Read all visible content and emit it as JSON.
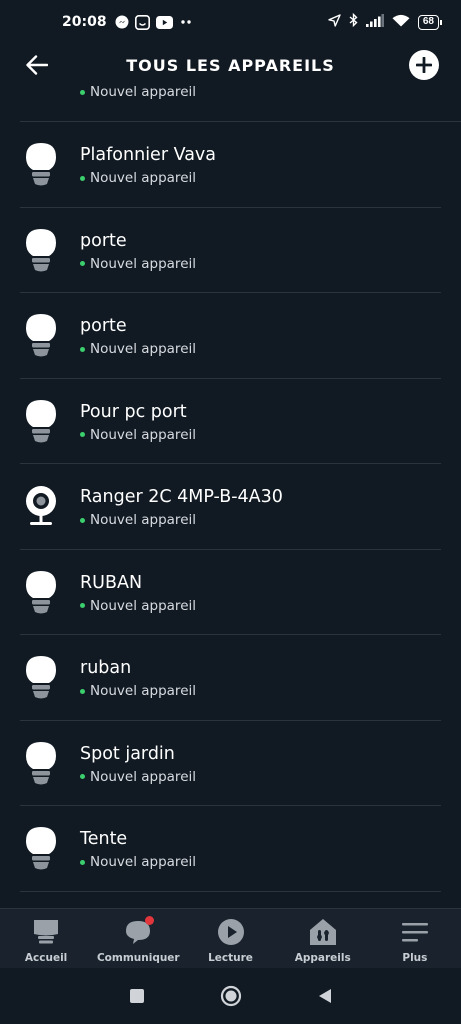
{
  "statusbar": {
    "time": "20:08",
    "battery": "68",
    "icons": [
      "messenger-icon",
      "app-icon",
      "youtube-icon",
      "more-dots-icon",
      "location-arrow-icon",
      "bluetooth-icon",
      "signal-icon",
      "wifi-icon",
      "battery-icon"
    ]
  },
  "header": {
    "title": "TOUS LES APPAREILS",
    "back_icon": "arrow-left-icon",
    "add_icon": "plus-circle-icon"
  },
  "partial_item": {
    "status": "Nouvel appareil"
  },
  "devices": [
    {
      "name": "Plafonnier Vava",
      "status": "Nouvel appareil",
      "icon": "bulb-icon"
    },
    {
      "name": "porte",
      "status": "Nouvel appareil",
      "icon": "bulb-icon"
    },
    {
      "name": "porte",
      "status": "Nouvel appareil",
      "icon": "bulb-icon"
    },
    {
      "name": "Pour pc port",
      "status": "Nouvel appareil",
      "icon": "bulb-icon"
    },
    {
      "name": "Ranger 2C 4MP-B-4A30",
      "status": "Nouvel appareil",
      "icon": "camera-icon"
    },
    {
      "name": "RUBAN",
      "status": "Nouvel appareil",
      "icon": "bulb-icon"
    },
    {
      "name": "ruban",
      "status": "Nouvel appareil",
      "icon": "bulb-icon"
    },
    {
      "name": "Spot jardin",
      "status": "Nouvel appareil",
      "icon": "bulb-icon"
    },
    {
      "name": "Tente",
      "status": "Nouvel appareil",
      "icon": "bulb-icon"
    }
  ],
  "bottomnav": [
    {
      "label": "Accueil",
      "icon": "home-icon"
    },
    {
      "label": "Communiquer",
      "icon": "chat-icon"
    },
    {
      "label": "Lecture",
      "icon": "play-icon"
    },
    {
      "label": "Appareils",
      "icon": "devices-house-icon"
    },
    {
      "label": "Plus",
      "icon": "menu-icon"
    }
  ],
  "colors": {
    "background": "#111a23",
    "status_dot": "#3ccf6e",
    "notification": "#e2353c",
    "divider": "#2a343e"
  }
}
